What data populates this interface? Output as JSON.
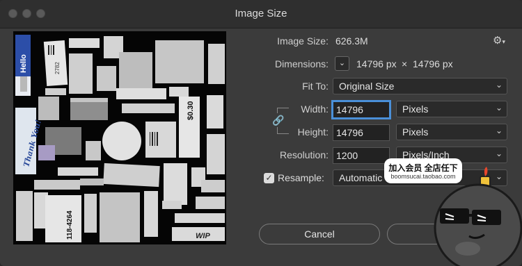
{
  "window": {
    "title": "Image Size"
  },
  "image_size": {
    "label": "Image Size:",
    "value": "626.3M"
  },
  "dimensions": {
    "label": "Dimensions:",
    "width": "14796 px",
    "times": "×",
    "height": "14796 px"
  },
  "fit_to": {
    "label": "Fit To:",
    "value": "Original Size"
  },
  "width": {
    "label": "Width:",
    "value": "14796",
    "unit": "Pixels"
  },
  "height": {
    "label": "Height:",
    "value": "14796",
    "unit": "Pixels"
  },
  "resolution": {
    "label": "Resolution:",
    "value": "1200",
    "unit": "Pixels/Inch"
  },
  "resample": {
    "label": "Resample:",
    "checked": true,
    "value": "Automatic"
  },
  "buttons": {
    "cancel": "Cancel",
    "ok": ""
  },
  "preview": {
    "texts": {
      "hello": "Hello",
      "thank": "Thank You!",
      "price": "$0.30",
      "wip": "WIP",
      "code": "118-4264",
      "barcode_num": "2782"
    }
  },
  "watermark": {
    "line1": "加入会员 全店任下",
    "line2": "boomsucai.taobao.com"
  },
  "colors": {
    "accent": "#4a90d9",
    "window_bg": "#3b3b3b",
    "field_bg": "#222222"
  }
}
